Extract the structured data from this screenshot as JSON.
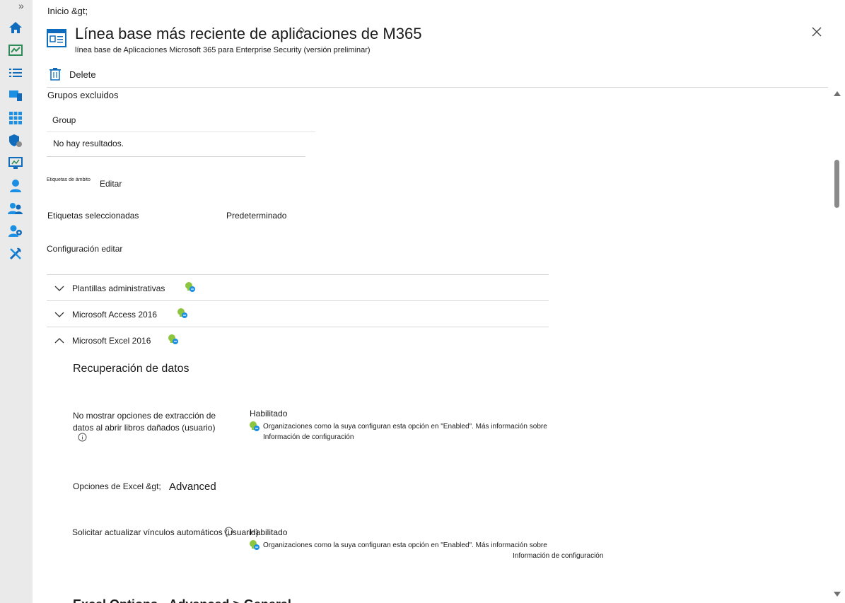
{
  "sidebar": {
    "expand": "»"
  },
  "header": {
    "breadcrumb": "Inicio &gt;",
    "title": "Línea base más reciente de aplicaciones de M365",
    "subtitle": "línea base de Aplicaciones Microsoft 365 para Enterprise Security (versión preliminar)"
  },
  "toolbar": {
    "delete_label": "Delete"
  },
  "excluded": {
    "heading": "Grupos excluidos",
    "column": "Group",
    "empty": "No hay resultados."
  },
  "scope": {
    "label": "Etiquetas de ámbito",
    "edit": "Editar",
    "selected_label": "Etiquetas seleccionadas",
    "selected_value": "Predeterminado"
  },
  "config": {
    "heading": "Configuración editar",
    "sections": [
      {
        "label": "Plantillas administrativas",
        "expanded": false
      },
      {
        "label": "Microsoft Access 2016",
        "expanded": false
      },
      {
        "label": "Microsoft Excel 2016",
        "expanded": true
      }
    ]
  },
  "excel": {
    "group_title": "Recuperación de datos",
    "settings": [
      {
        "name": "No mostrar opciones de extracción de datos al abrir libros dañados (usuario)",
        "value": "Habilitado",
        "note": "Organizaciones como la suya configuran esta opción en \"Enabled\". Más información sobre",
        "link": "Información de configuración"
      },
      {
        "name": "Solicitar actualizar vínculos automáticos (usuario)",
        "value": "Habilitado",
        "note": "Organizaciones como la suya configuran esta opción en \"Enabled\". Más información sobre",
        "link": "Información de configuración"
      }
    ],
    "options_label": "Opciones de Excel &gt;",
    "options_value": "Advanced",
    "cut_heading": "Excel Options - Advanced > General"
  },
  "colors": {
    "accent": "#0f6cbd",
    "bulb": "#8cc63f"
  }
}
